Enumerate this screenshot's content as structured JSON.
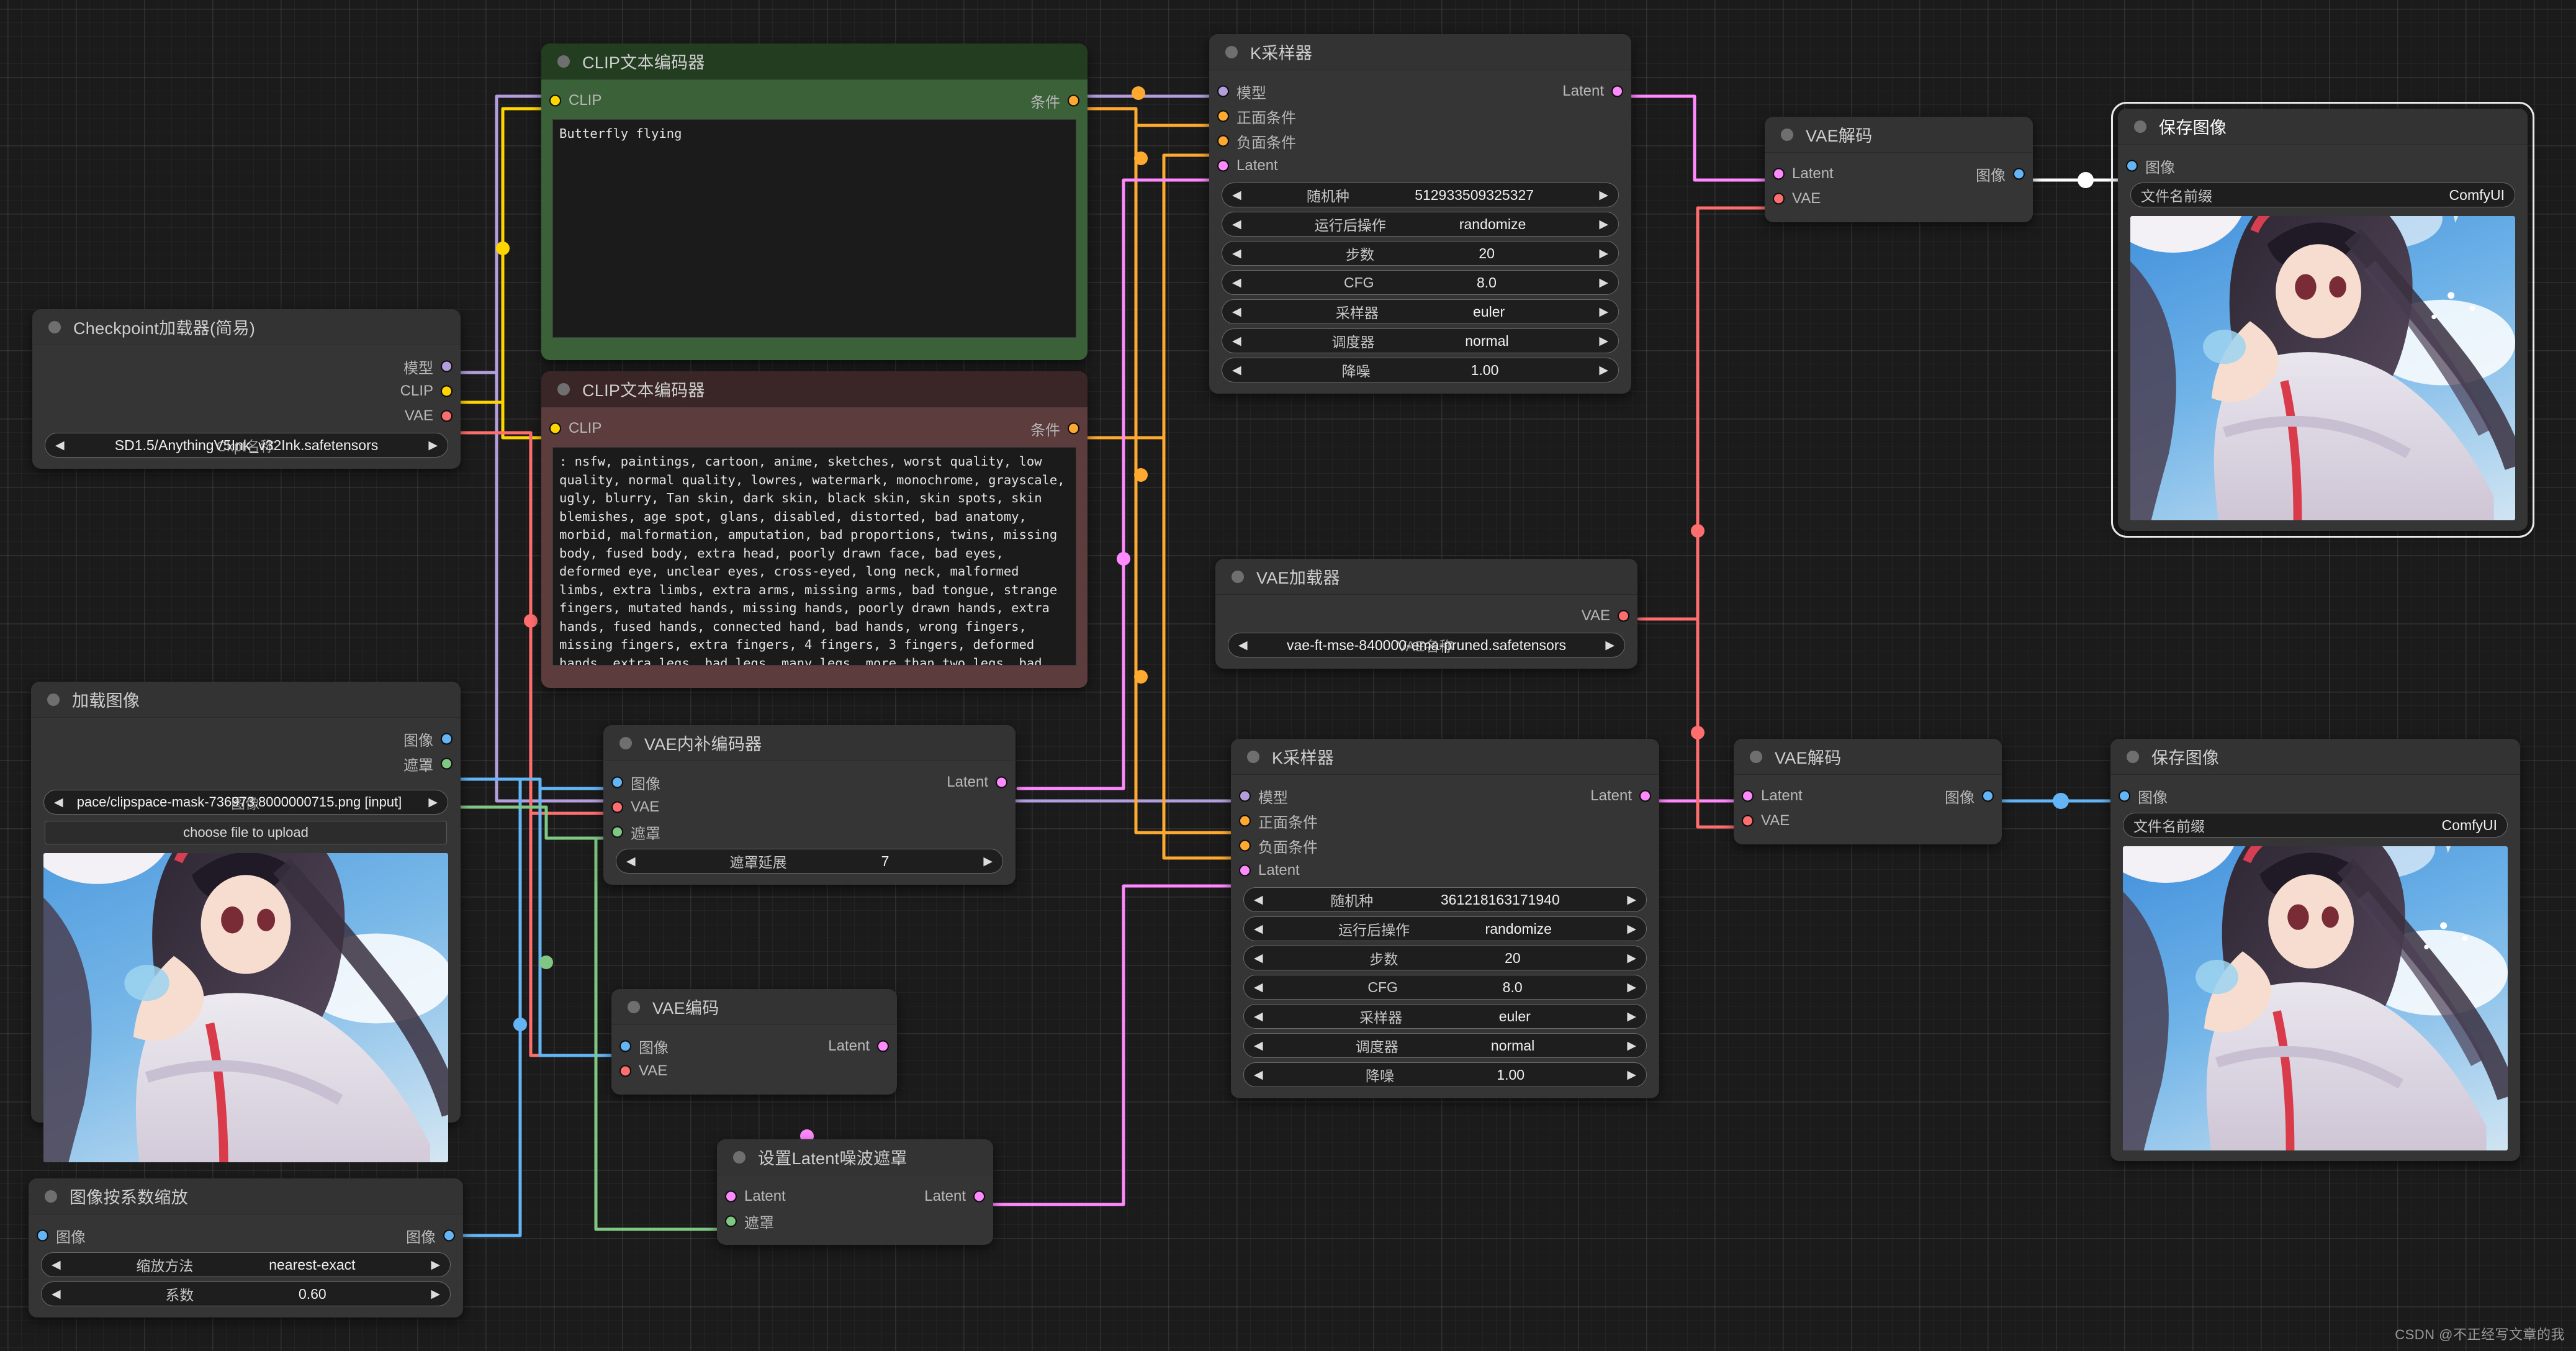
{
  "app": {
    "name": "ComfyUI",
    "watermark": "CSDN @不正经写文章的我",
    "canvas_bg": "#1b1b1b"
  },
  "port_colors": {
    "model": "#b39ddb",
    "clip": "#ffd500",
    "vae": "#ff6e6e",
    "conditioning": "#ffa931",
    "latent": "#ff8aff",
    "image": "#64b5f6",
    "mask": "#81c784"
  },
  "nodes": {
    "checkpoint_loader": {
      "title": "Checkpoint加载器(简易)",
      "outputs": [
        {
          "label": "模型",
          "type": "model"
        },
        {
          "label": "CLIP",
          "type": "clip"
        },
        {
          "label": "VAE",
          "type": "vae"
        }
      ],
      "widgets": [
        {
          "name": "Ckpt名称",
          "value": "SD1.5/AnythingV5Ink_v32Ink.safetensors"
        }
      ]
    },
    "clip_positive": {
      "title": "CLIP文本编码器",
      "inputs": [
        {
          "label": "CLIP",
          "type": "clip"
        }
      ],
      "outputs": [
        {
          "label": "条件",
          "type": "conditioning"
        }
      ],
      "text": "Butterfly flying"
    },
    "clip_negative": {
      "title": "CLIP文本编码器",
      "inputs": [
        {
          "label": "CLIP",
          "type": "clip"
        }
      ],
      "outputs": [
        {
          "label": "条件",
          "type": "conditioning"
        }
      ],
      "text": ": nsfw, paintings, cartoon, anime, sketches, worst quality, low quality, normal quality, lowres, watermark, monochrome, grayscale, ugly, blurry, Tan skin, dark skin, black skin, skin spots, skin blemishes, age spot, glans, disabled, distorted, bad anatomy, morbid, malformation, amputation, bad proportions, twins, missing body, fused body, extra head, poorly drawn face, bad eyes, deformed eye, unclear eyes, cross-eyed, long neck, malformed limbs, extra limbs, extra arms, missing arms, bad tongue, strange fingers, mutated hands, missing hands, poorly drawn hands, extra hands, fused hands, connected hand, bad hands, wrong fingers, missing fingers, extra fingers, 4 fingers, 3 fingers, deformed hands, extra legs, bad legs, many legs, more than two legs, bad feet"
    },
    "ksampler_top": {
      "title": "K采样器",
      "inputs": [
        {
          "label": "模型",
          "type": "model"
        },
        {
          "label": "正面条件",
          "type": "conditioning"
        },
        {
          "label": "负面条件",
          "type": "conditioning"
        },
        {
          "label": "Latent",
          "type": "latent"
        }
      ],
      "outputs": [
        {
          "label": "Latent",
          "type": "latent"
        }
      ],
      "widgets": [
        {
          "name": "随机种",
          "value": "512933509325327"
        },
        {
          "name": "运行后操作",
          "value": "randomize"
        },
        {
          "name": "步数",
          "value": "20"
        },
        {
          "name": "CFG",
          "value": "8.0"
        },
        {
          "name": "采样器",
          "value": "euler"
        },
        {
          "name": "调度器",
          "value": "normal"
        },
        {
          "name": "降噪",
          "value": "1.00"
        }
      ]
    },
    "ksampler_bottom": {
      "title": "K采样器",
      "inputs": [
        {
          "label": "模型",
          "type": "model"
        },
        {
          "label": "正面条件",
          "type": "conditioning"
        },
        {
          "label": "负面条件",
          "type": "conditioning"
        },
        {
          "label": "Latent",
          "type": "latent"
        }
      ],
      "outputs": [
        {
          "label": "Latent",
          "type": "latent"
        }
      ],
      "widgets": [
        {
          "name": "随机种",
          "value": "361218163171940"
        },
        {
          "name": "运行后操作",
          "value": "randomize"
        },
        {
          "name": "步数",
          "value": "20"
        },
        {
          "name": "CFG",
          "value": "8.0"
        },
        {
          "name": "采样器",
          "value": "euler"
        },
        {
          "name": "调度器",
          "value": "normal"
        },
        {
          "name": "降噪",
          "value": "1.00"
        }
      ]
    },
    "vae_decode_top": {
      "title": "VAE解码",
      "inputs": [
        {
          "label": "Latent",
          "type": "latent"
        },
        {
          "label": "VAE",
          "type": "vae"
        }
      ],
      "outputs": [
        {
          "label": "图像",
          "type": "image"
        }
      ]
    },
    "vae_decode_bottom": {
      "title": "VAE解码",
      "inputs": [
        {
          "label": "Latent",
          "type": "latent"
        },
        {
          "label": "VAE",
          "type": "vae"
        }
      ],
      "outputs": [
        {
          "label": "图像",
          "type": "image"
        }
      ]
    },
    "save_image_top": {
      "title": "保存图像",
      "selected": true,
      "inputs": [
        {
          "label": "图像",
          "type": "image"
        }
      ],
      "widgets": [
        {
          "name": "文件名前缀",
          "value": "ComfyUI"
        }
      ]
    },
    "save_image_bottom": {
      "title": "保存图像",
      "selected": false,
      "inputs": [
        {
          "label": "图像",
          "type": "image"
        }
      ],
      "widgets": [
        {
          "name": "文件名前缀",
          "value": "ComfyUI"
        }
      ]
    },
    "vae_loader": {
      "title": "VAE加载器",
      "outputs": [
        {
          "label": "VAE",
          "type": "vae"
        }
      ],
      "widgets": [
        {
          "name": "VAE名称",
          "value": "vae-ft-mse-840000-ema-pruned.safetensors"
        }
      ]
    },
    "load_image": {
      "title": "加载图像",
      "outputs": [
        {
          "label": "图像",
          "type": "image"
        },
        {
          "label": "遮罩",
          "type": "mask"
        }
      ],
      "widgets": [
        {
          "name": "图像",
          "value": "pace/clipspace-mask-736973.8000000715.png [input]"
        }
      ],
      "upload_button": "choose file to upload"
    },
    "vae_encode_inpaint": {
      "title": "VAE内补编码器",
      "inputs": [
        {
          "label": "图像",
          "type": "image"
        },
        {
          "label": "VAE",
          "type": "vae"
        },
        {
          "label": "遮罩",
          "type": "mask"
        }
      ],
      "outputs": [
        {
          "label": "Latent",
          "type": "latent"
        }
      ],
      "widgets": [
        {
          "name": "遮罩延展",
          "value": "7"
        }
      ]
    },
    "vae_encode": {
      "title": "VAE编码",
      "inputs": [
        {
          "label": "图像",
          "type": "image"
        },
        {
          "label": "VAE",
          "type": "vae"
        }
      ],
      "outputs": [
        {
          "label": "Latent",
          "type": "latent"
        }
      ]
    },
    "set_latent_noise_mask": {
      "title": "设置Latent噪波遮罩",
      "inputs": [
        {
          "label": "Latent",
          "type": "latent"
        },
        {
          "label": "遮罩",
          "type": "mask"
        }
      ],
      "outputs": [
        {
          "label": "Latent",
          "type": "latent"
        }
      ]
    },
    "image_scale_by": {
      "title": "图像按系数缩放",
      "inputs": [
        {
          "label": "图像",
          "type": "image"
        }
      ],
      "outputs": [
        {
          "label": "图像",
          "type": "image"
        }
      ],
      "widgets": [
        {
          "name": "缩放方法",
          "value": "nearest-exact"
        },
        {
          "name": "系数",
          "value": "0.60"
        }
      ]
    }
  }
}
